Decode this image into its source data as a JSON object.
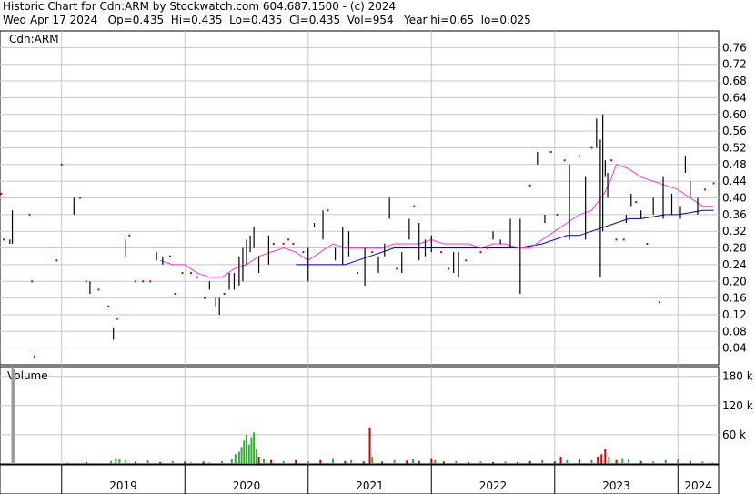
{
  "header": {
    "line1": "Historic Chart for Cdn:ARM by Stockwatch.com 604.687.1500 - (c) 2024",
    "line2": "Wed Apr 17 2024   Op=0.435  Hi=0.435  Lo=0.435  Cl=0.435  Vol=954   Year hi=0.65  lo=0.025"
  },
  "chart_data": {
    "type": "line",
    "symbol_label": "Cdn:ARM",
    "volume_label": "Volume",
    "price_axis": {
      "ylim": [
        0.0,
        0.8
      ],
      "ticks": [
        "0.04",
        "0.08",
        "0.12",
        "0.16",
        "0.20",
        "0.24",
        "0.28",
        "0.32",
        "0.36",
        "0.40",
        "0.44",
        "0.48",
        "0.52",
        "0.56",
        "0.60",
        "0.64",
        "0.68",
        "0.72",
        "0.76"
      ]
    },
    "volume_axis": {
      "ylim": [
        0,
        200
      ],
      "ticks": [
        "60 k",
        "120 k",
        "180 k"
      ]
    },
    "x_axis": {
      "xlim": [
        2018.5,
        2024.33
      ],
      "years": [
        "2019",
        "2020",
        "2021",
        "2022",
        "2023",
        "2024"
      ]
    },
    "grid": true,
    "colors": {
      "up": "#cc0000",
      "down": "#000000",
      "ma_short": "#ff33cc",
      "ma_long": "#0000cc",
      "vol_up": "#33aa33",
      "vol_down": "#cc0000",
      "grid": "#c8c8c8"
    },
    "price_bars": [
      {
        "x": 2018.51,
        "lo": 0.41,
        "hi": 0.41
      },
      {
        "x": 2018.53,
        "lo": 0.3,
        "hi": 0.3
      },
      {
        "x": 2018.58,
        "lo": 0.29,
        "hi": 0.3
      },
      {
        "x": 2018.6,
        "lo": 0.29,
        "hi": 0.37
      },
      {
        "x": 2018.74,
        "lo": 0.36,
        "hi": 0.36
      },
      {
        "x": 2018.76,
        "lo": 0.2,
        "hi": 0.2
      },
      {
        "x": 2018.78,
        "lo": 0.02,
        "hi": 0.02
      },
      {
        "x": 2018.96,
        "lo": 0.25,
        "hi": 0.25
      },
      {
        "x": 2019.0,
        "lo": 0.48,
        "hi": 0.48
      },
      {
        "x": 2019.1,
        "lo": 0.36,
        "hi": 0.4
      },
      {
        "x": 2019.15,
        "lo": 0.4,
        "hi": 0.4
      },
      {
        "x": 2019.2,
        "lo": 0.2,
        "hi": 0.2
      },
      {
        "x": 2019.23,
        "lo": 0.17,
        "hi": 0.2
      },
      {
        "x": 2019.3,
        "lo": 0.18,
        "hi": 0.18
      },
      {
        "x": 2019.38,
        "lo": 0.14,
        "hi": 0.14
      },
      {
        "x": 2019.42,
        "lo": 0.06,
        "hi": 0.09
      },
      {
        "x": 2019.45,
        "lo": 0.11,
        "hi": 0.11
      },
      {
        "x": 2019.52,
        "lo": 0.26,
        "hi": 0.3
      },
      {
        "x": 2019.55,
        "lo": 0.31,
        "hi": 0.31
      },
      {
        "x": 2019.6,
        "lo": 0.2,
        "hi": 0.2
      },
      {
        "x": 2019.66,
        "lo": 0.2,
        "hi": 0.2
      },
      {
        "x": 2019.72,
        "lo": 0.2,
        "hi": 0.2
      },
      {
        "x": 2019.77,
        "lo": 0.25,
        "hi": 0.27
      },
      {
        "x": 2019.82,
        "lo": 0.24,
        "hi": 0.26
      },
      {
        "x": 2019.88,
        "lo": 0.26,
        "hi": 0.26
      },
      {
        "x": 2019.92,
        "lo": 0.17,
        "hi": 0.17
      },
      {
        "x": 2019.98,
        "lo": 0.22,
        "hi": 0.22
      },
      {
        "x": 2020.05,
        "lo": 0.22,
        "hi": 0.22
      },
      {
        "x": 2020.1,
        "lo": 0.21,
        "hi": 0.21
      },
      {
        "x": 2020.16,
        "lo": 0.16,
        "hi": 0.16
      },
      {
        "x": 2020.2,
        "lo": 0.18,
        "hi": 0.2
      },
      {
        "x": 2020.25,
        "lo": 0.14,
        "hi": 0.16
      },
      {
        "x": 2020.28,
        "lo": 0.12,
        "hi": 0.16
      },
      {
        "x": 2020.32,
        "lo": 0.17,
        "hi": 0.17
      },
      {
        "x": 2020.36,
        "lo": 0.18,
        "hi": 0.22
      },
      {
        "x": 2020.4,
        "lo": 0.18,
        "hi": 0.22
      },
      {
        "x": 2020.44,
        "lo": 0.19,
        "hi": 0.26
      },
      {
        "x": 2020.47,
        "lo": 0.2,
        "hi": 0.28
      },
      {
        "x": 2020.5,
        "lo": 0.24,
        "hi": 0.3
      },
      {
        "x": 2020.53,
        "lo": 0.27,
        "hi": 0.31
      },
      {
        "x": 2020.56,
        "lo": 0.28,
        "hi": 0.33
      },
      {
        "x": 2020.6,
        "lo": 0.22,
        "hi": 0.26
      },
      {
        "x": 2020.68,
        "lo": 0.24,
        "hi": 0.31
      },
      {
        "x": 2020.72,
        "lo": 0.29,
        "hi": 0.29
      },
      {
        "x": 2020.8,
        "lo": 0.29,
        "hi": 0.29
      },
      {
        "x": 2020.84,
        "lo": 0.3,
        "hi": 0.3
      },
      {
        "x": 2020.88,
        "lo": 0.29,
        "hi": 0.29
      },
      {
        "x": 2020.96,
        "lo": 0.27,
        "hi": 0.27
      },
      {
        "x": 2021.0,
        "lo": 0.2,
        "hi": 0.28
      },
      {
        "x": 2021.05,
        "lo": 0.33,
        "hi": 0.34
      },
      {
        "x": 2021.12,
        "lo": 0.3,
        "hi": 0.37
      },
      {
        "x": 2021.16,
        "lo": 0.37,
        "hi": 0.37
      },
      {
        "x": 2021.22,
        "lo": 0.25,
        "hi": 0.28
      },
      {
        "x": 2021.28,
        "lo": 0.24,
        "hi": 0.33
      },
      {
        "x": 2021.33,
        "lo": 0.26,
        "hi": 0.32
      },
      {
        "x": 2021.4,
        "lo": 0.22,
        "hi": 0.22
      },
      {
        "x": 2021.46,
        "lo": 0.19,
        "hi": 0.28
      },
      {
        "x": 2021.52,
        "lo": 0.27,
        "hi": 0.27
      },
      {
        "x": 2021.57,
        "lo": 0.22,
        "hi": 0.26
      },
      {
        "x": 2021.62,
        "lo": 0.26,
        "hi": 0.29
      },
      {
        "x": 2021.66,
        "lo": 0.35,
        "hi": 0.4
      },
      {
        "x": 2021.72,
        "lo": 0.23,
        "hi": 0.23
      },
      {
        "x": 2021.76,
        "lo": 0.22,
        "hi": 0.27
      },
      {
        "x": 2021.82,
        "lo": 0.3,
        "hi": 0.35
      },
      {
        "x": 2021.86,
        "lo": 0.38,
        "hi": 0.38
      },
      {
        "x": 2021.9,
        "lo": 0.25,
        "hi": 0.34
      },
      {
        "x": 2021.95,
        "lo": 0.26,
        "hi": 0.3
      },
      {
        "x": 2022.0,
        "lo": 0.27,
        "hi": 0.31
      },
      {
        "x": 2022.08,
        "lo": 0.27,
        "hi": 0.27
      },
      {
        "x": 2022.14,
        "lo": 0.23,
        "hi": 0.23
      },
      {
        "x": 2022.18,
        "lo": 0.22,
        "hi": 0.27
      },
      {
        "x": 2022.22,
        "lo": 0.21,
        "hi": 0.27
      },
      {
        "x": 2022.28,
        "lo": 0.25,
        "hi": 0.25
      },
      {
        "x": 2022.4,
        "lo": 0.27,
        "hi": 0.27
      },
      {
        "x": 2022.45,
        "lo": 0.28,
        "hi": 0.28
      },
      {
        "x": 2022.5,
        "lo": 0.3,
        "hi": 0.32
      },
      {
        "x": 2022.56,
        "lo": 0.29,
        "hi": 0.3
      },
      {
        "x": 2022.64,
        "lo": 0.28,
        "hi": 0.35
      },
      {
        "x": 2022.72,
        "lo": 0.17,
        "hi": 0.35
      },
      {
        "x": 2022.8,
        "lo": 0.43,
        "hi": 0.43
      },
      {
        "x": 2022.86,
        "lo": 0.48,
        "hi": 0.51
      },
      {
        "x": 2022.92,
        "lo": 0.34,
        "hi": 0.36
      },
      {
        "x": 2022.97,
        "lo": 0.51,
        "hi": 0.51
      },
      {
        "x": 2023.02,
        "lo": 0.36,
        "hi": 0.36
      },
      {
        "x": 2023.08,
        "lo": 0.49,
        "hi": 0.49
      },
      {
        "x": 2023.12,
        "lo": 0.3,
        "hi": 0.48
      },
      {
        "x": 2023.2,
        "lo": 0.5,
        "hi": 0.5
      },
      {
        "x": 2023.25,
        "lo": 0.3,
        "hi": 0.45
      },
      {
        "x": 2023.3,
        "lo": 0.52,
        "hi": 0.52
      },
      {
        "x": 2023.34,
        "lo": 0.52,
        "hi": 0.59
      },
      {
        "x": 2023.37,
        "lo": 0.21,
        "hi": 0.54
      },
      {
        "x": 2023.39,
        "lo": 0.32,
        "hi": 0.6
      },
      {
        "x": 2023.41,
        "lo": 0.45,
        "hi": 0.49
      },
      {
        "x": 2023.43,
        "lo": 0.4,
        "hi": 0.46
      },
      {
        "x": 2023.46,
        "lo": 0.49,
        "hi": 0.49
      },
      {
        "x": 2023.5,
        "lo": 0.3,
        "hi": 0.3
      },
      {
        "x": 2023.56,
        "lo": 0.3,
        "hi": 0.3
      },
      {
        "x": 2023.58,
        "lo": 0.34,
        "hi": 0.36
      },
      {
        "x": 2023.62,
        "lo": 0.38,
        "hi": 0.41
      },
      {
        "x": 2023.66,
        "lo": 0.39,
        "hi": 0.39
      },
      {
        "x": 2023.7,
        "lo": 0.35,
        "hi": 0.37
      },
      {
        "x": 2023.75,
        "lo": 0.29,
        "hi": 0.29
      },
      {
        "x": 2023.8,
        "lo": 0.36,
        "hi": 0.4
      },
      {
        "x": 2023.85,
        "lo": 0.15,
        "hi": 0.15
      },
      {
        "x": 2023.88,
        "lo": 0.35,
        "hi": 0.45
      },
      {
        "x": 2023.95,
        "lo": 0.36,
        "hi": 0.41
      },
      {
        "x": 2024.02,
        "lo": 0.35,
        "hi": 0.38
      },
      {
        "x": 2024.06,
        "lo": 0.46,
        "hi": 0.5
      },
      {
        "x": 2024.1,
        "lo": 0.4,
        "hi": 0.44
      },
      {
        "x": 2024.16,
        "lo": 0.36,
        "hi": 0.4
      },
      {
        "x": 2024.22,
        "lo": 0.42,
        "hi": 0.42
      },
      {
        "x": 2024.29,
        "lo": 0.435,
        "hi": 0.435
      }
    ],
    "ma_short": {
      "x": [
        2019.8,
        2019.9,
        2020.0,
        2020.1,
        2020.2,
        2020.3,
        2020.4,
        2020.5,
        2020.6,
        2020.7,
        2020.8,
        2020.9,
        2021.0,
        2021.1,
        2021.2,
        2021.3,
        2021.4,
        2021.5,
        2021.6,
        2021.7,
        2021.8,
        2021.9,
        2022.0,
        2022.1,
        2022.2,
        2022.3,
        2022.4,
        2022.5,
        2022.6,
        2022.7,
        2022.8,
        2022.9,
        2023.0,
        2023.1,
        2023.2,
        2023.3,
        2023.35,
        2023.4,
        2023.45,
        2023.5,
        2023.6,
        2023.7,
        2023.8,
        2023.9,
        2024.0,
        2024.1,
        2024.2,
        2024.29
      ],
      "y": [
        0.25,
        0.24,
        0.24,
        0.22,
        0.21,
        0.21,
        0.23,
        0.24,
        0.26,
        0.27,
        0.28,
        0.27,
        0.25,
        0.27,
        0.29,
        0.28,
        0.28,
        0.28,
        0.28,
        0.29,
        0.29,
        0.29,
        0.3,
        0.29,
        0.29,
        0.29,
        0.28,
        0.29,
        0.29,
        0.28,
        0.28,
        0.3,
        0.32,
        0.34,
        0.36,
        0.37,
        0.39,
        0.41,
        0.44,
        0.48,
        0.47,
        0.45,
        0.44,
        0.43,
        0.42,
        0.4,
        0.38,
        0.38
      ]
    },
    "ma_long": {
      "x": [
        2020.9,
        2021.0,
        2021.1,
        2021.2,
        2021.3,
        2021.4,
        2021.5,
        2021.6,
        2021.7,
        2021.8,
        2021.9,
        2022.0,
        2022.1,
        2022.2,
        2022.3,
        2022.4,
        2022.5,
        2022.6,
        2022.7,
        2022.8,
        2022.9,
        2023.0,
        2023.1,
        2023.2,
        2023.3,
        2023.4,
        2023.5,
        2023.6,
        2023.7,
        2023.8,
        2023.9,
        2024.0,
        2024.1,
        2024.2,
        2024.29
      ],
      "y": [
        0.24,
        0.24,
        0.24,
        0.24,
        0.24,
        0.25,
        0.26,
        0.27,
        0.28,
        0.28,
        0.28,
        0.28,
        0.28,
        0.28,
        0.28,
        0.28,
        0.28,
        0.28,
        0.28,
        0.285,
        0.29,
        0.3,
        0.31,
        0.31,
        0.32,
        0.33,
        0.34,
        0.35,
        0.35,
        0.355,
        0.36,
        0.36,
        0.365,
        0.37,
        0.37
      ]
    },
    "volume": [
      {
        "x": 2018.6,
        "v": 200,
        "c": "gray"
      },
      {
        "x": 2018.61,
        "v": 195,
        "c": "gray"
      },
      {
        "x": 2019.05,
        "v": 3,
        "c": "up"
      },
      {
        "x": 2019.2,
        "v": 4,
        "c": "down"
      },
      {
        "x": 2019.4,
        "v": 6,
        "c": "up"
      },
      {
        "x": 2019.44,
        "v": 12,
        "c": "up"
      },
      {
        "x": 2019.47,
        "v": 10,
        "c": "up"
      },
      {
        "x": 2019.52,
        "v": 8,
        "c": "up"
      },
      {
        "x": 2019.6,
        "v": 5,
        "c": "down"
      },
      {
        "x": 2019.7,
        "v": 7,
        "c": "up"
      },
      {
        "x": 2019.8,
        "v": 4,
        "c": "down"
      },
      {
        "x": 2019.9,
        "v": 6,
        "c": "up"
      },
      {
        "x": 2020.0,
        "v": 5,
        "c": "down"
      },
      {
        "x": 2020.05,
        "v": 3,
        "c": "up"
      },
      {
        "x": 2020.15,
        "v": 5,
        "c": "down"
      },
      {
        "x": 2020.2,
        "v": 3,
        "c": "up"
      },
      {
        "x": 2020.3,
        "v": 6,
        "c": "up"
      },
      {
        "x": 2020.38,
        "v": 10,
        "c": "up"
      },
      {
        "x": 2020.41,
        "v": 20,
        "c": "up"
      },
      {
        "x": 2020.44,
        "v": 25,
        "c": "up"
      },
      {
        "x": 2020.46,
        "v": 35,
        "c": "up"
      },
      {
        "x": 2020.48,
        "v": 48,
        "c": "up"
      },
      {
        "x": 2020.5,
        "v": 60,
        "c": "up"
      },
      {
        "x": 2020.52,
        "v": 40,
        "c": "up"
      },
      {
        "x": 2020.54,
        "v": 55,
        "c": "up"
      },
      {
        "x": 2020.56,
        "v": 65,
        "c": "up"
      },
      {
        "x": 2020.58,
        "v": 30,
        "c": "up"
      },
      {
        "x": 2020.6,
        "v": 15,
        "c": "down"
      },
      {
        "x": 2020.64,
        "v": 10,
        "c": "up"
      },
      {
        "x": 2020.7,
        "v": 8,
        "c": "down"
      },
      {
        "x": 2020.8,
        "v": 6,
        "c": "up"
      },
      {
        "x": 2020.9,
        "v": 8,
        "c": "down"
      },
      {
        "x": 2021.0,
        "v": 5,
        "c": "up"
      },
      {
        "x": 2021.1,
        "v": 8,
        "c": "down"
      },
      {
        "x": 2021.2,
        "v": 12,
        "c": "up"
      },
      {
        "x": 2021.3,
        "v": 6,
        "c": "down"
      },
      {
        "x": 2021.35,
        "v": 8,
        "c": "up"
      },
      {
        "x": 2021.45,
        "v": 5,
        "c": "down"
      },
      {
        "x": 2021.5,
        "v": 75,
        "c": "down"
      },
      {
        "x": 2021.52,
        "v": 15,
        "c": "up"
      },
      {
        "x": 2021.6,
        "v": 5,
        "c": "down"
      },
      {
        "x": 2021.7,
        "v": 8,
        "c": "up"
      },
      {
        "x": 2021.8,
        "v": 7,
        "c": "down"
      },
      {
        "x": 2021.85,
        "v": 10,
        "c": "up"
      },
      {
        "x": 2021.9,
        "v": 6,
        "c": "down"
      },
      {
        "x": 2022.0,
        "v": 12,
        "c": "down"
      },
      {
        "x": 2022.03,
        "v": 8,
        "c": "up"
      },
      {
        "x": 2022.1,
        "v": 5,
        "c": "down"
      },
      {
        "x": 2022.2,
        "v": 6,
        "c": "up"
      },
      {
        "x": 2022.3,
        "v": 4,
        "c": "down"
      },
      {
        "x": 2022.4,
        "v": 5,
        "c": "up"
      },
      {
        "x": 2022.5,
        "v": 4,
        "c": "down"
      },
      {
        "x": 2022.6,
        "v": 5,
        "c": "up"
      },
      {
        "x": 2022.7,
        "v": 4,
        "c": "down"
      },
      {
        "x": 2022.8,
        "v": 6,
        "c": "down"
      },
      {
        "x": 2022.9,
        "v": 8,
        "c": "up"
      },
      {
        "x": 2023.0,
        "v": 5,
        "c": "down"
      },
      {
        "x": 2023.05,
        "v": 15,
        "c": "down"
      },
      {
        "x": 2023.1,
        "v": 8,
        "c": "up"
      },
      {
        "x": 2023.2,
        "v": 10,
        "c": "down"
      },
      {
        "x": 2023.3,
        "v": 8,
        "c": "up"
      },
      {
        "x": 2023.35,
        "v": 15,
        "c": "down"
      },
      {
        "x": 2023.38,
        "v": 20,
        "c": "down"
      },
      {
        "x": 2023.41,
        "v": 30,
        "c": "down"
      },
      {
        "x": 2023.44,
        "v": 15,
        "c": "up"
      },
      {
        "x": 2023.5,
        "v": 8,
        "c": "down"
      },
      {
        "x": 2023.55,
        "v": 12,
        "c": "up"
      },
      {
        "x": 2023.6,
        "v": 10,
        "c": "up"
      },
      {
        "x": 2023.7,
        "v": 6,
        "c": "down"
      },
      {
        "x": 2023.8,
        "v": 5,
        "c": "up"
      },
      {
        "x": 2023.9,
        "v": 8,
        "c": "up"
      },
      {
        "x": 2024.0,
        "v": 10,
        "c": "up"
      },
      {
        "x": 2024.1,
        "v": 6,
        "c": "down"
      },
      {
        "x": 2024.2,
        "v": 5,
        "c": "up"
      },
      {
        "x": 2024.28,
        "v": 3,
        "c": "up"
      }
    ]
  }
}
